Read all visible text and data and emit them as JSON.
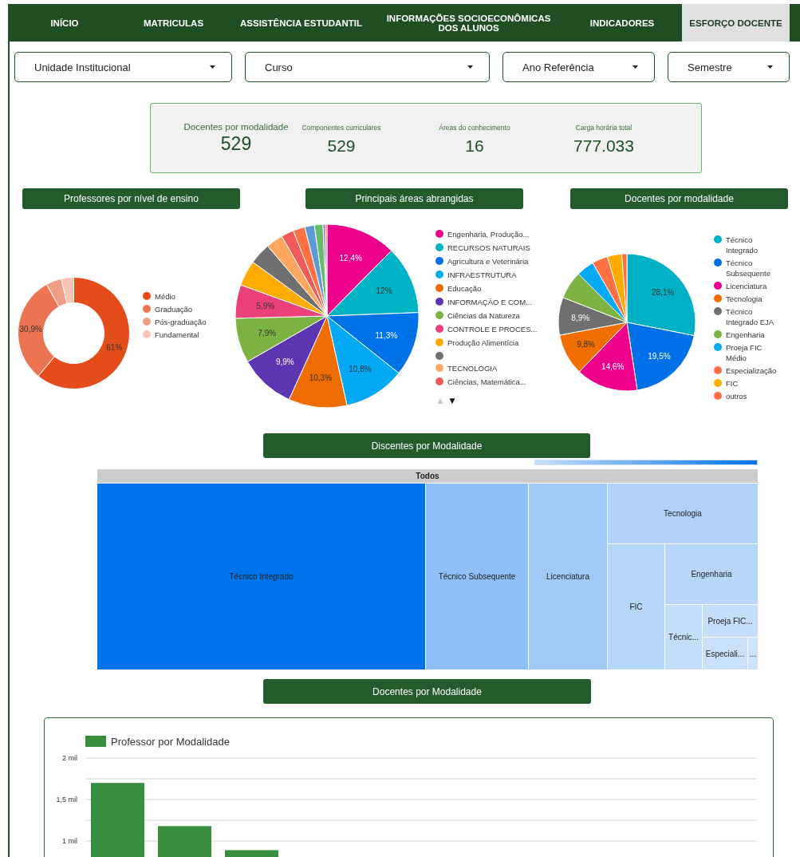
{
  "nav": {
    "tabs": [
      {
        "label": "INÍCIO",
        "selected": false
      },
      {
        "label": "MATRICULAS",
        "selected": false
      },
      {
        "label": "ASSISTÊNCIA ESTUDANTIL",
        "selected": false
      },
      {
        "label": "INFORMAÇÕES SOCIOECONÔMICAS DOS ALUNOS",
        "selected": false
      },
      {
        "label": "INDICADORES",
        "selected": false
      },
      {
        "label": "ESFORÇO DOCENTE",
        "selected": true
      }
    ]
  },
  "filters": [
    {
      "label": "Unidade Institucional"
    },
    {
      "label": "Curso"
    },
    {
      "label": "Ano Referência"
    },
    {
      "label": "Semestre"
    }
  ],
  "summary": [
    {
      "kind": "primary",
      "label": "Docentes por modalidade",
      "value": "529"
    },
    {
      "kind": "secondary",
      "label": "Componentes curriculares",
      "value": "529"
    },
    {
      "kind": "secondary",
      "label": "Áreas do conhecimento",
      "value": "16"
    },
    {
      "kind": "secondary",
      "label": "Carga horária total",
      "value": "777.033"
    }
  ],
  "charts": [
    {
      "title": "Professores por nível de ensino",
      "legend": [
        {
          "label": "Médio",
          "color": "#e44d1a"
        },
        {
          "label": "Graduação",
          "color": "#ec7551"
        },
        {
          "label": "Pós-graduação",
          "color": "#f19c84"
        },
        {
          "label": "Fundamental",
          "color": "#f6c3b5"
        }
      ],
      "chart_data": {
        "type": "donut",
        "values": [
          61,
          30.9,
          4.5,
          3.6
        ],
        "colors": [
          "#e44d1a",
          "#ec7551",
          "#f19c84",
          "#f6c3b5"
        ],
        "value_labels": [
          "61%",
          "30,9%",
          null,
          null
        ]
      }
    },
    {
      "title": "Principais áreas abrangidas",
      "legend": [
        {
          "label": "Engenharia, Produção...",
          "color": "#ec008c"
        },
        {
          "label": "RECURSOS NATURAIS",
          "color": "#00b3c4"
        },
        {
          "label": "Agricultura e Veterinária",
          "color": "#0072e8"
        },
        {
          "label": "INFRAESTRUTURA",
          "color": "#03a9f4"
        },
        {
          "label": "Educação",
          "color": "#ef6c00"
        },
        {
          "label": "INFORMAÇÃO E COM...",
          "color": "#5e35b1"
        },
        {
          "label": "Ciências da Natureza",
          "color": "#7cb342"
        },
        {
          "label": "CONTROLE E PROCES...",
          "color": "#ec407a"
        },
        {
          "label": "Produção Alimentícia",
          "color": "#ffab00"
        },
        {
          "color": "#6f6f6f"
        },
        {
          "label": "TECNOLOGIA",
          "color": "#ffa75e"
        },
        {
          "label": "Ciências, Matemática...",
          "color": "#ef5a5a"
        }
      ],
      "legend_pager": [
        {
          "glyph": "▲",
          "disabled": true
        },
        {
          "glyph": "▼",
          "disabled": false
        }
      ],
      "chart_data": {
        "type": "pie",
        "values": [
          12.4,
          12,
          11.3,
          10.8,
          10.3,
          9.9,
          7.9,
          5.9,
          4.5,
          3.8,
          3.0,
          2.2,
          2.1,
          1.7,
          1.5,
          0.4,
          0.3
        ],
        "colors": [
          "#ec008c",
          "#00b3c4",
          "#0072e8",
          "#03a9f4",
          "#ef6c00",
          "#5e35b1",
          "#7cb342",
          "#ec407a",
          "#ffab00",
          "#6f6f6f",
          "#ffa75e",
          "#ef5a5a",
          "#ff7043",
          "#5c9bd6",
          "#66bb6a",
          "#9c5fb5",
          "#e0574f"
        ],
        "value_labels": [
          "12,4%",
          "12%",
          "11,3%",
          "10,8%",
          "10,3%",
          "9,9%",
          "7,9%",
          "5,9%",
          null,
          null,
          null,
          null,
          null,
          null,
          null,
          null,
          null
        ]
      }
    },
    {
      "title": "Docentes por modalidade",
      "legend": [
        {
          "label": "Técnico Integrado",
          "color": "#00b0c4"
        },
        {
          "label": "Técnico Subsequente",
          "color": "#0070e8"
        },
        {
          "label": "Licenciatura",
          "color": "#ec008c"
        },
        {
          "label": "Tecnologia",
          "color": "#f06d00"
        },
        {
          "label": "Técnico Integrado EJA",
          "color": "#6f6f6f"
        },
        {
          "label": "Engenharia",
          "color": "#7cb342"
        },
        {
          "label": "Proeja FIC Médio",
          "color": "#03a9f4"
        },
        {
          "label": "Especialização",
          "color": "#ff7043"
        },
        {
          "label": "FIC",
          "color": "#ffab00"
        },
        {
          "label": "outros",
          "color": "#ff6e40"
        }
      ],
      "chart_data": {
        "type": "pie",
        "values": [
          28.1,
          19.5,
          14.6,
          9.8,
          8.9,
          6.6,
          4.2,
          3.7,
          3.4,
          1.2
        ],
        "colors": [
          "#00b0c4",
          "#0070e8",
          "#ec008c",
          "#f06d00",
          "#6f6f6f",
          "#7cb342",
          "#03a9f4",
          "#ff7043",
          "#ffab00",
          "#ff6e40"
        ],
        "value_labels": [
          "28,1%",
          "19,5%",
          "14,6%",
          "9,8%",
          "8,9%",
          null,
          null,
          null,
          null,
          null
        ]
      }
    }
  ],
  "treemap": {
    "title": "Discentes por Modalidade",
    "root": "Todos",
    "tiles": [
      {
        "label": "Técnico Integrado",
        "color": "#0073ea"
      },
      {
        "label": "Técnico Subsequente",
        "color": "#8fbff7"
      },
      {
        "label": "Licenciatura",
        "color": "#a0c9f8"
      },
      {
        "label": "Tecnologia",
        "color": "#b0d3fa"
      },
      {
        "label": "FIC",
        "color": "#b6d6fa"
      },
      {
        "label": "Engenharia",
        "color": "#b6d6fa"
      },
      {
        "label": "Técnic...",
        "color": "#c4defb"
      },
      {
        "label": "Proeja FIC...",
        "color": "#c4defb"
      },
      {
        "label": "Especiali...",
        "color": "#c8e0fb"
      },
      {
        "label": "...",
        "color": "#cde3fc"
      }
    ]
  },
  "bar_section": {
    "title": "Docentes por Modalidade",
    "chart_data": {
      "type": "bar",
      "series": [
        {
          "name": "Professor por Modalidade",
          "color": "#388e3c",
          "values": [
            1.7,
            1.18,
            0.89
          ]
        }
      ],
      "ylim": [
        0,
        2
      ],
      "yticks": [
        {
          "value": 1,
          "label": "1 mil"
        },
        {
          "value": 1.5,
          "label": "1,5 mil"
        },
        {
          "value": 2,
          "label": "2 mil"
        }
      ]
    }
  }
}
